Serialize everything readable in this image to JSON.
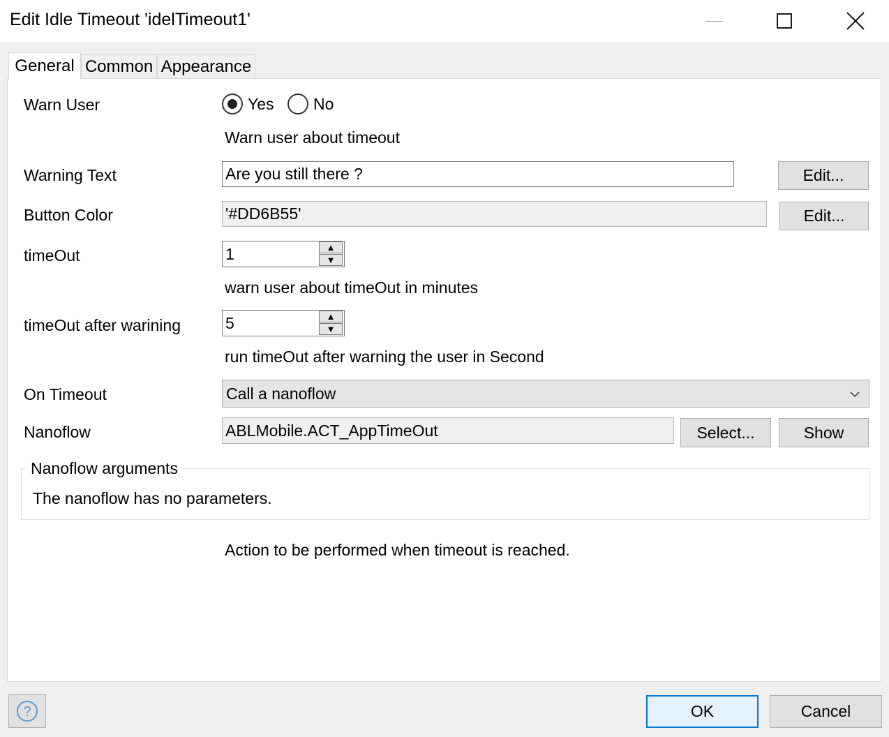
{
  "window": {
    "title": "Edit Idle Timeout 'idelTimeout1'",
    "controls": [
      "minimize-icon",
      "maximize-icon",
      "close-icon"
    ]
  },
  "tabs": [
    {
      "label": "General",
      "active": true
    },
    {
      "label": "Common",
      "active": false
    },
    {
      "label": "Appearance",
      "active": false
    }
  ],
  "form": {
    "warn_user": {
      "label": "Warn User",
      "options": [
        {
          "label": "Yes",
          "selected": true
        },
        {
          "label": "No",
          "selected": false
        }
      ],
      "hint": "Warn user about timeout"
    },
    "warning_text": {
      "label": "Warning Text",
      "value": "Are you still there ?",
      "button": "Edit..."
    },
    "button_color": {
      "label": "Button Color",
      "value": "'#DD6B55'",
      "button": "Edit..."
    },
    "timeout": {
      "label": "timeOut",
      "value": "1",
      "hint": "warn user about timeOut in minutes"
    },
    "timeout_after_warning": {
      "label": "timeOut after warining",
      "value": "5",
      "hint": "run timeOut after warning the user in Second"
    },
    "on_timeout": {
      "label": "On Timeout",
      "value": "Call a nanoflow"
    },
    "nanoflow": {
      "label": "Nanoflow",
      "value": "ABLMobile.ACT_AppTimeOut",
      "select_button": "Select...",
      "show_button": "Show"
    },
    "nanoflow_arguments": {
      "legend": "Nanoflow arguments",
      "message": "The nanoflow has no parameters."
    },
    "action_hint": "Action to be performed when timeout is reached."
  },
  "footer": {
    "help_icon": "help-icon",
    "ok_label": "OK",
    "cancel_label": "Cancel"
  },
  "colors": {
    "accent_border": "#0078d7",
    "button_bg": "#e1e1e1",
    "help_icon": "#5b9bd5"
  }
}
